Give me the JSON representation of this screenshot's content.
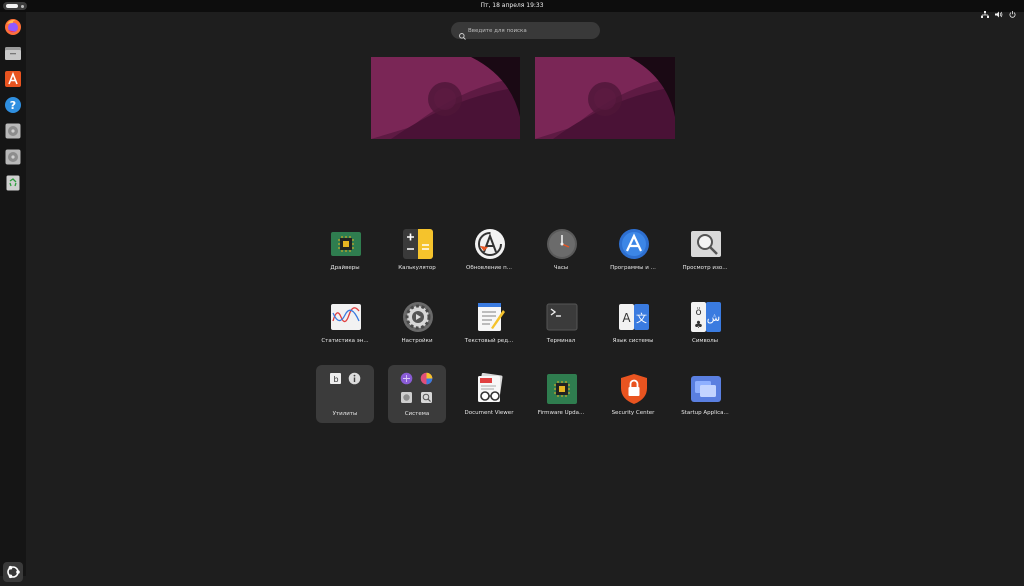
{
  "topbar": {
    "clock": "Пт, 18 апреля  19:33"
  },
  "dock": {
    "items": [
      {
        "name": "firefox-icon"
      },
      {
        "name": "files-icon"
      },
      {
        "name": "app-center-icon"
      },
      {
        "name": "help-icon"
      },
      {
        "name": "disk-icon"
      },
      {
        "name": "disk-icon"
      },
      {
        "name": "trash-icon"
      }
    ],
    "show_apps": "ubuntu-logo-icon"
  },
  "search": {
    "placeholder": "Введите для поиска"
  },
  "apps": {
    "row1": [
      {
        "label": "Драйверы",
        "icon": "chip-icon"
      },
      {
        "label": "Калькулятор",
        "icon": "calculator-icon"
      },
      {
        "label": "Обновление п...",
        "icon": "updater-icon"
      },
      {
        "label": "Часы",
        "icon": "clock-icon"
      },
      {
        "label": "Программы и ...",
        "icon": "software-icon"
      },
      {
        "label": "Просмотр изо...",
        "icon": "image-viewer-icon"
      }
    ],
    "row2": [
      {
        "label": "Статистика эн...",
        "icon": "power-stats-icon"
      },
      {
        "label": "Настройки",
        "icon": "settings-icon"
      },
      {
        "label": "Текстовый ред...",
        "icon": "text-editor-icon"
      },
      {
        "label": "Терминал",
        "icon": "terminal-icon"
      },
      {
        "label": "Язык системы",
        "icon": "language-icon"
      },
      {
        "label": "Символы",
        "icon": "characters-icon"
      }
    ],
    "row3": [
      {
        "label": "Утилиты",
        "icon": "folder-icon"
      },
      {
        "label": "Система",
        "icon": "folder-icon"
      },
      {
        "label": "Document Viewer",
        "icon": "document-viewer-icon"
      },
      {
        "label": "Firmware Upda...",
        "icon": "firmware-icon"
      },
      {
        "label": "Security Center",
        "icon": "lock-icon"
      },
      {
        "label": "Startup Applica...",
        "icon": "startup-icon"
      }
    ]
  },
  "colors": {
    "background": "#1e1e1e",
    "panel": "#0d0d0d",
    "dock": "#151515",
    "accent": "#e95420",
    "wallpaper": "#6b1d4a"
  }
}
